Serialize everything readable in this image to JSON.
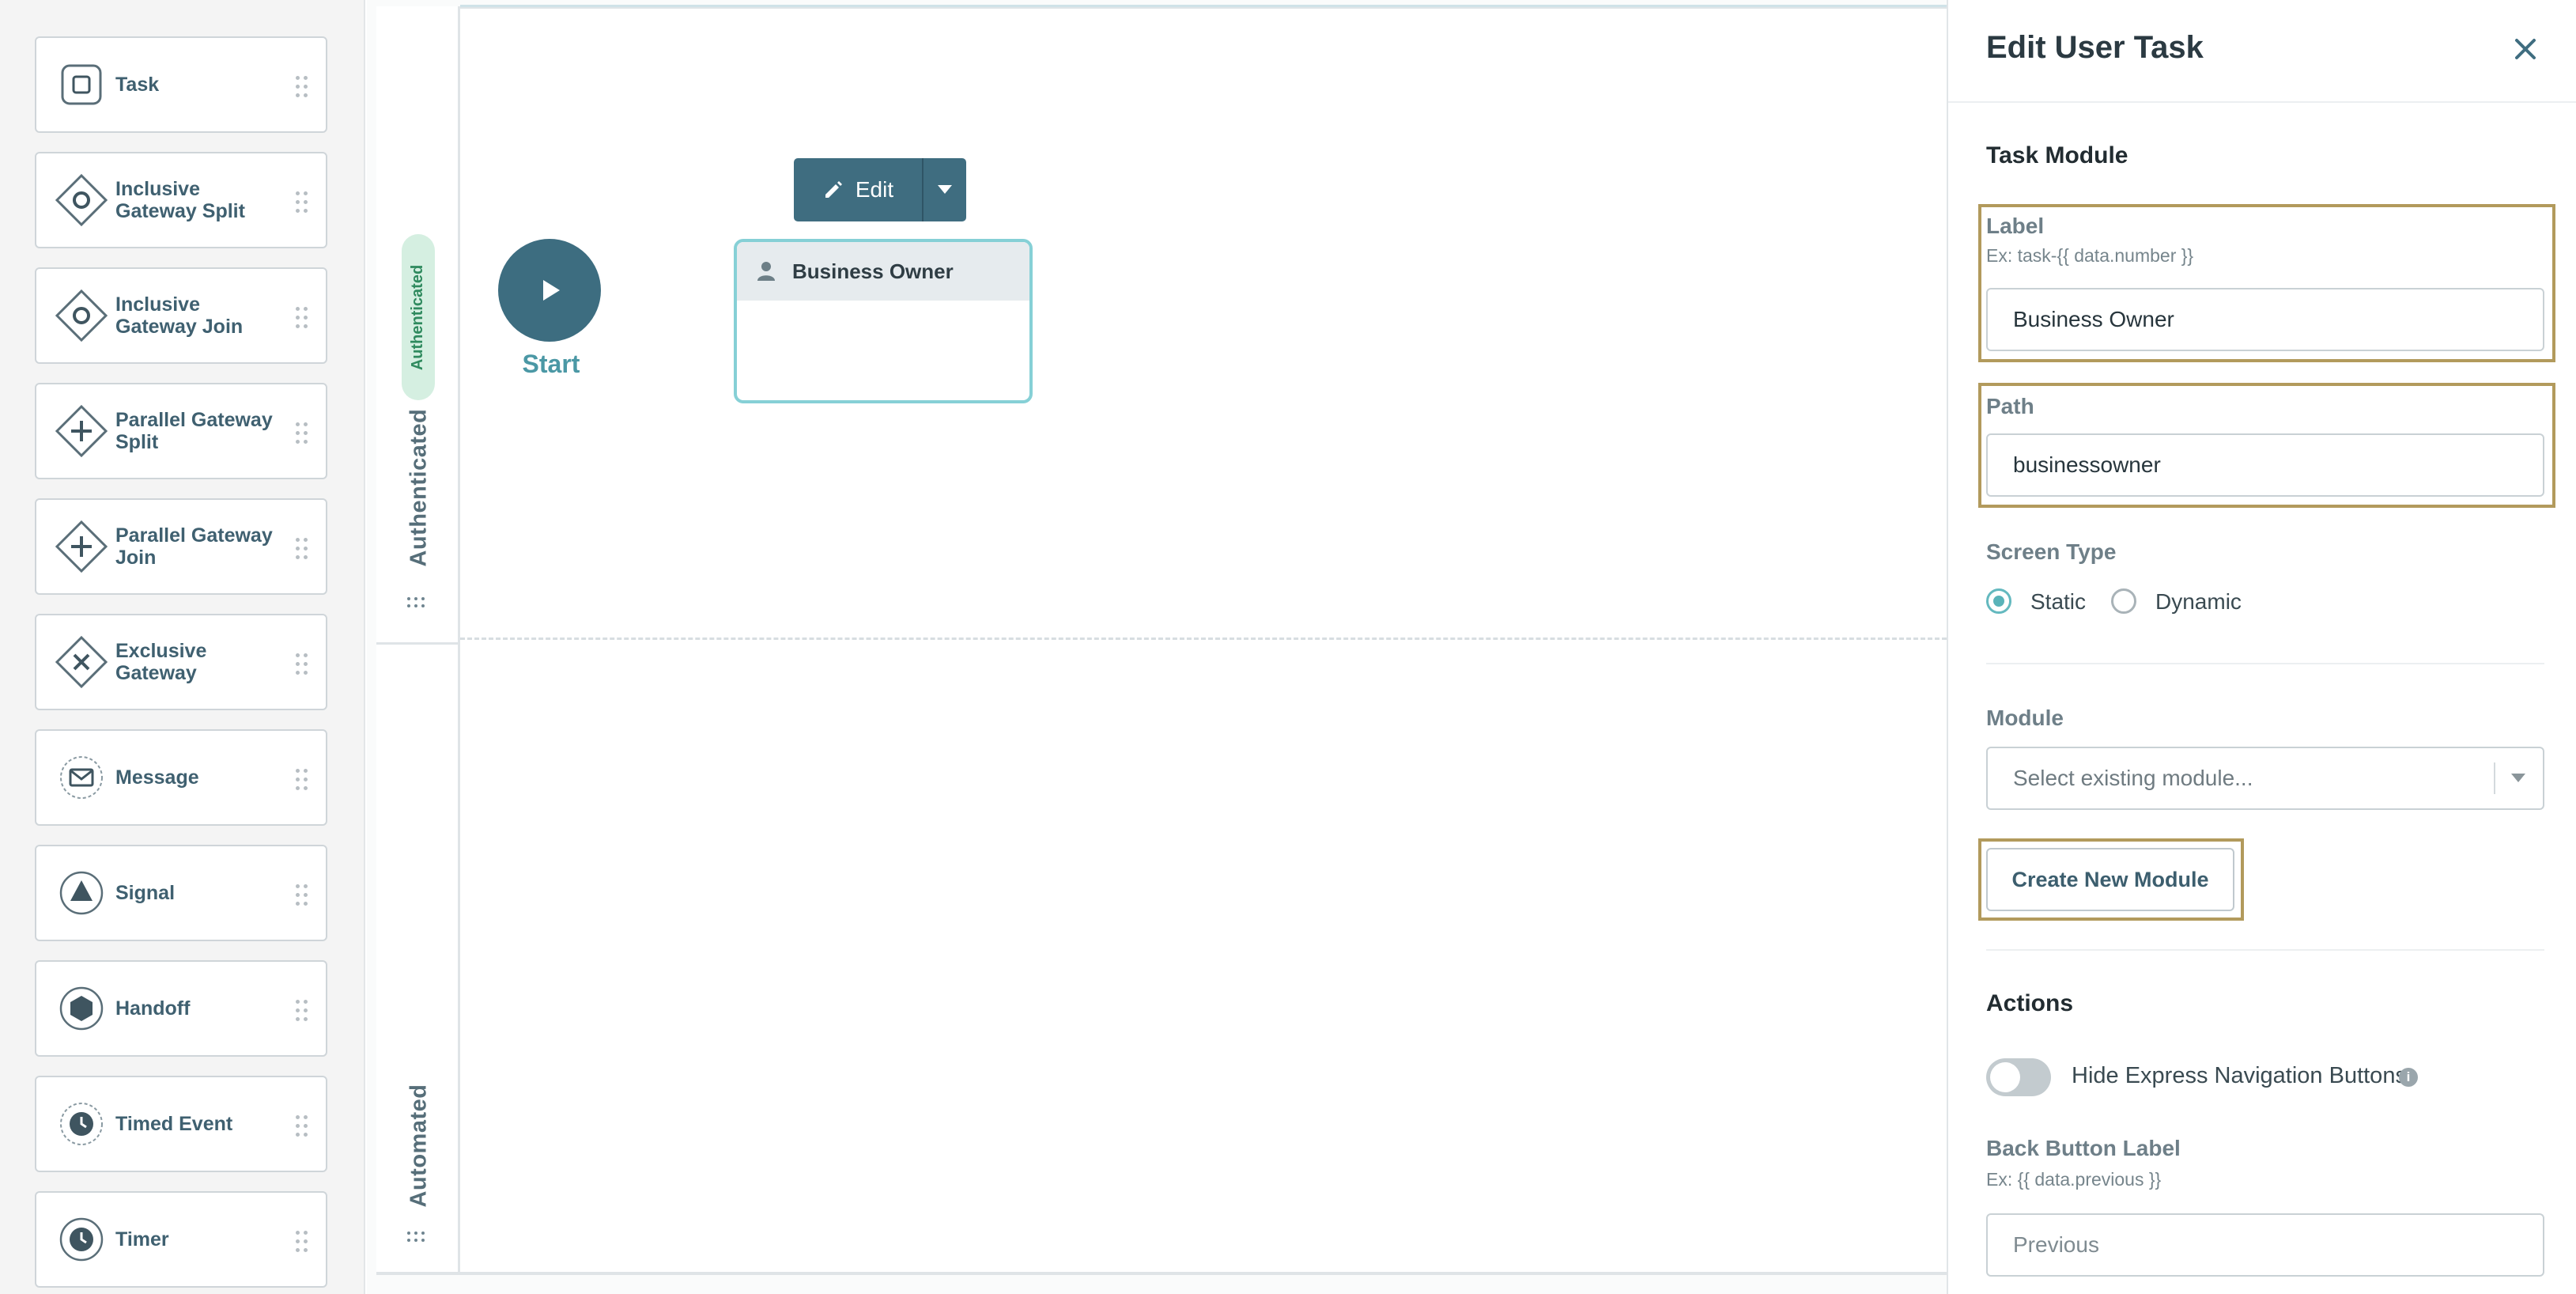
{
  "palette": {
    "items": [
      {
        "label": "Task",
        "icon": "task-square-icon"
      },
      {
        "label": "Inclusive Gateway Split",
        "icon": "inclusive-gateway-icon"
      },
      {
        "label": "Inclusive Gateway Join",
        "icon": "inclusive-gateway-icon"
      },
      {
        "label": "Parallel Gateway Split",
        "icon": "parallel-gateway-icon"
      },
      {
        "label": "Parallel Gateway Join",
        "icon": "parallel-gateway-icon"
      },
      {
        "label": "Exclusive Gateway",
        "icon": "exclusive-gateway-icon"
      },
      {
        "label": "Message",
        "icon": "message-envelope-icon"
      },
      {
        "label": "Signal",
        "icon": "signal-triangle-icon"
      },
      {
        "label": "Handoff",
        "icon": "handoff-hexagon-icon"
      },
      {
        "label": "Timed Event",
        "icon": "timed-event-clock-icon"
      },
      {
        "label": "Timer",
        "icon": "timer-clock-icon"
      }
    ]
  },
  "canvas": {
    "lane1": {
      "pill": "Authenticated",
      "name": "Authenticated"
    },
    "lane2": {
      "name": "Automated"
    },
    "start_label": "Start",
    "edit_label": "Edit",
    "task_node_label": "Business Owner"
  },
  "panel": {
    "title": "Edit User Task",
    "section_task_module": "Task Module",
    "label_field": {
      "label": "Label",
      "hint": "Ex: task-{{ data.number }}",
      "value": "Business Owner"
    },
    "path_field": {
      "label": "Path",
      "value": "businessowner"
    },
    "screen_type": {
      "label": "Screen Type",
      "options": [
        "Static",
        "Dynamic"
      ],
      "selected": "Static"
    },
    "module": {
      "label": "Module",
      "placeholder": "Select existing module..."
    },
    "create_module_label": "Create New Module",
    "section_actions": "Actions",
    "hide_express_nav": {
      "label": "Hide Express Navigation Buttons",
      "on": false
    },
    "back_button": {
      "label": "Back Button Label",
      "hint": "Ex: {{ data.previous }}",
      "placeholder": "Previous"
    }
  },
  "colors": {
    "accent_teal": "#59b3b9",
    "primary_slate": "#3f6d80",
    "highlight_gold": "#b29a5c",
    "authenticated_green": "#2f8a5e"
  }
}
